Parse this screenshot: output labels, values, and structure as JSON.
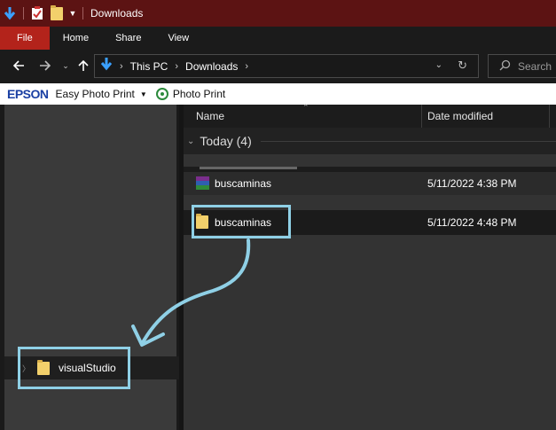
{
  "titlebar": {
    "title": "Downloads"
  },
  "ribbon": {
    "tabs": [
      "File",
      "Home",
      "Share",
      "View"
    ]
  },
  "nav": {
    "breadcrumb": [
      "This PC",
      "Downloads"
    ],
    "search_placeholder": "Search"
  },
  "epson": {
    "brand": "EPSON",
    "easy_photo_print": "Easy Photo Print",
    "photo_print": "Photo Print"
  },
  "columns": {
    "name": "Name",
    "date_modified": "Date modified"
  },
  "group": {
    "label": "Today (4)"
  },
  "files": [
    {
      "name": "buscaminas",
      "date": "5/11/2022 4:38 PM",
      "icon": "winrar-archive-icon"
    },
    {
      "name": "buscaminas",
      "date": "5/11/2022 4:48 PM",
      "icon": "folder-icon"
    }
  ],
  "navpane": {
    "item": "visualStudio"
  },
  "colors": {
    "titlebar": "#5c1313",
    "file_tab": "#b3231b",
    "highlight": "#8fd0e6",
    "folder": "#f2d06b"
  }
}
